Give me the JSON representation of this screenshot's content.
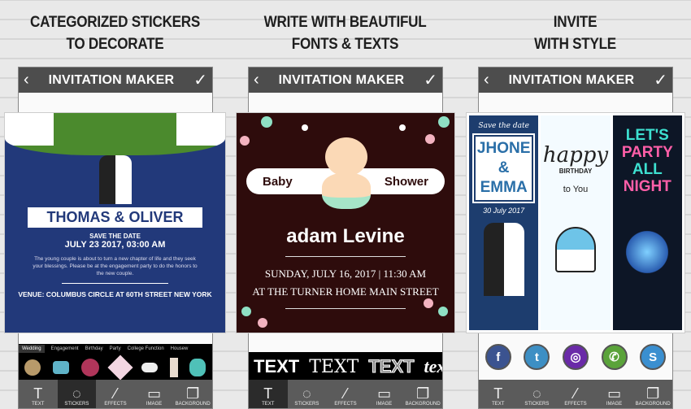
{
  "panels": [
    {
      "headline": [
        "CATEGORIZED STICKERS",
        "TO DECORATE"
      ]
    },
    {
      "headline": [
        "WRITE WITH BEAUTIFUL",
        "FONTS & TEXTS"
      ]
    },
    {
      "headline": [
        "INVITE",
        "WITH STYLE"
      ]
    }
  ],
  "app": {
    "title": "INVITATION MAKER",
    "back_icon": "chevron-left-icon",
    "confirm_icon": "check-icon"
  },
  "toolbar": [
    "TEXT",
    "STICKERS",
    "EFFECTS",
    "IMAGE",
    "BACKGROUND"
  ],
  "wedding": {
    "names": "THOMAS & OLIVER",
    "save": "SAVE THE DATE",
    "date": "JULY 23 2017, 03:00 AM",
    "body": "The young couple is about to turn a new chapter of life and they seek your blessings. Please be at the engagement party to do the honors to the new couple.",
    "venue": "VENUE: COLUMBUS CIRCLE AT 60TH STREET NEW YORK"
  },
  "sticker_tabs": [
    "Wedding",
    "Engagement",
    "Birthday",
    "Party",
    "College Function",
    "Housew"
  ],
  "baby": {
    "left": "Baby",
    "right": "Shower",
    "name": "adam Levine",
    "date": "SUNDAY, JULY 16, 2017 | 11:30 AM",
    "place": "AT THE TURNER HOME MAIN STREET"
  },
  "fonts": [
    "TEXT",
    "TEXT",
    "TEXT",
    "text"
  ],
  "cards": {
    "save": "Save the date",
    "n1": "JHONE",
    "amp": "&",
    "n2": "EMMA",
    "date": "30 July 2017",
    "happy": "happy",
    "bday": "BIRTHDAY",
    "you": "to You",
    "party": [
      "LET'S",
      "PARTY",
      "ALL",
      "NIGHT"
    ]
  },
  "social": [
    {
      "name": "facebook",
      "glyph": "f",
      "color": "#3b5390"
    },
    {
      "name": "twitter",
      "glyph": "t",
      "color": "#3d8fc4"
    },
    {
      "name": "instagram",
      "glyph": "◎",
      "color": "#6a2aa8"
    },
    {
      "name": "whatsapp",
      "glyph": "✆",
      "color": "#5aa33a"
    },
    {
      "name": "skype",
      "glyph": "S",
      "color": "#3a8fd0"
    }
  ]
}
